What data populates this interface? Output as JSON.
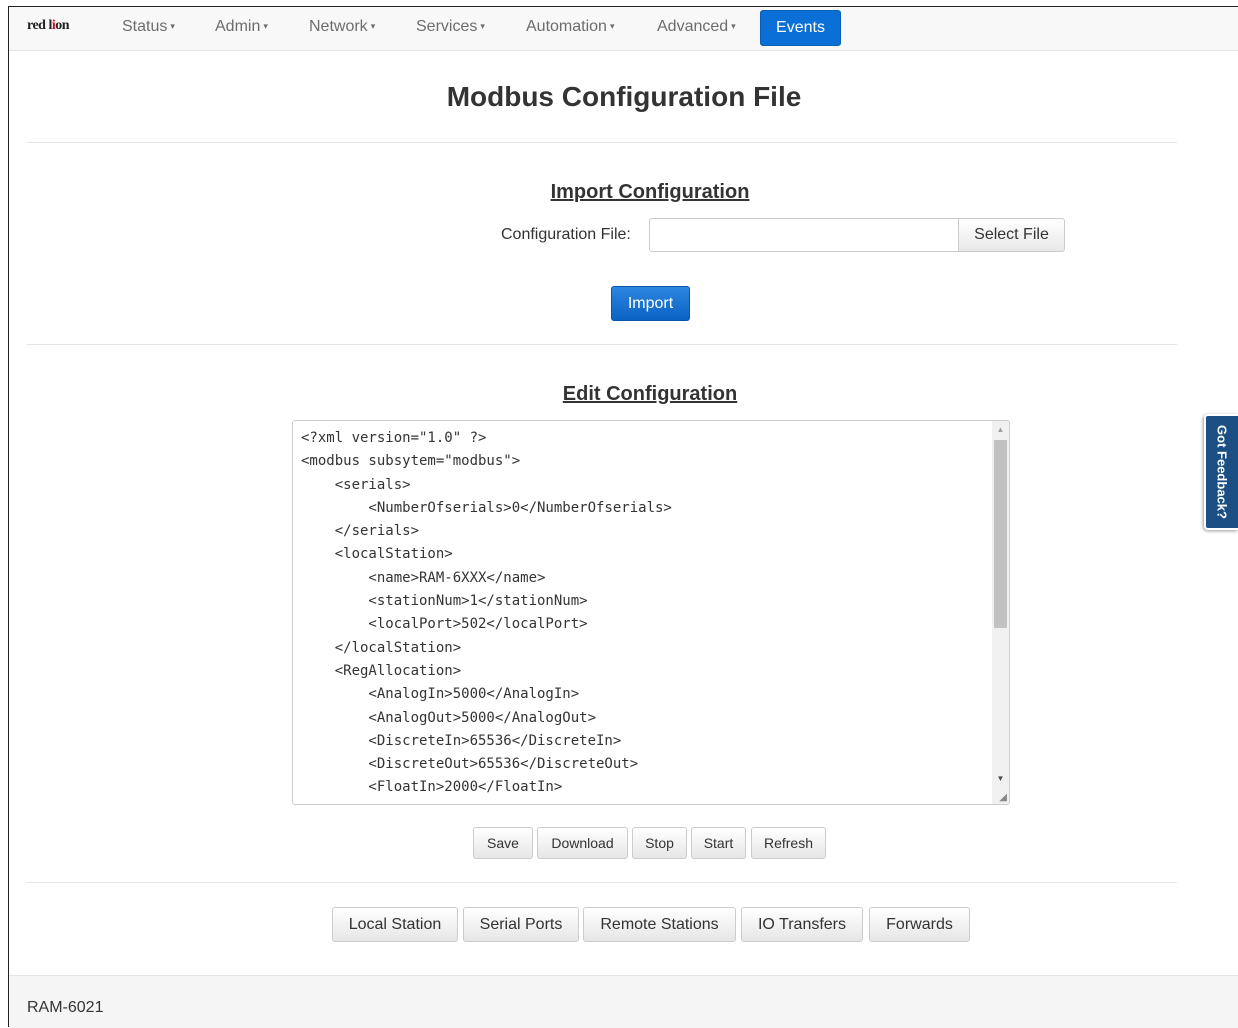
{
  "nav": {
    "logo_prefix": "red l",
    "logo_mark": "i",
    "logo_suffix": "on",
    "items": [
      {
        "label": "Status"
      },
      {
        "label": "Admin"
      },
      {
        "label": "Network"
      },
      {
        "label": "Services"
      },
      {
        "label": "Automation"
      },
      {
        "label": "Advanced"
      }
    ],
    "dropdown_glyph": "▾",
    "active_item": "Events",
    "accent_color": "#0a6fd6"
  },
  "page": {
    "title": "Modbus Configuration File"
  },
  "import_section": {
    "title": "Import Configuration",
    "file_label": "Configuration File:",
    "file_value": "",
    "select_file_label": "Select File",
    "import_label": "Import"
  },
  "edit_section": {
    "title": "Edit Configuration",
    "content": "<?xml version=\"1.0\" ?>\n<modbus subsytem=\"modbus\">\n    <serials>\n        <NumberOfserials>0</NumberOfserials>\n    </serials>\n    <localStation>\n        <name>RAM-6XXX</name>\n        <stationNum>1</stationNum>\n        <localPort>502</localPort>\n    </localStation>\n    <RegAllocation>\n        <AnalogIn>5000</AnalogIn>\n        <AnalogOut>5000</AnalogOut>\n        <DiscreteIn>65536</DiscreteIn>\n        <DiscreteOut>65536</DiscreteOut>\n        <FloatIn>2000</FloatIn>",
    "scroll_up_glyph": "▲",
    "scroll_down_glyph": "▼",
    "resize_glyph": "◢",
    "buttons": {
      "save": "Save",
      "download": "Download",
      "stop": "Stop",
      "start": "Start",
      "refresh": "Refresh"
    }
  },
  "subnav": {
    "local_station": "Local Station",
    "serial_ports": "Serial Ports",
    "remote_stations": "Remote Stations",
    "io_transfers": "IO Transfers",
    "forwards": "Forwards"
  },
  "footer": {
    "device": "RAM-6021"
  },
  "feedback": {
    "label": "Got Feedback?",
    "color": "#1b4f83"
  }
}
